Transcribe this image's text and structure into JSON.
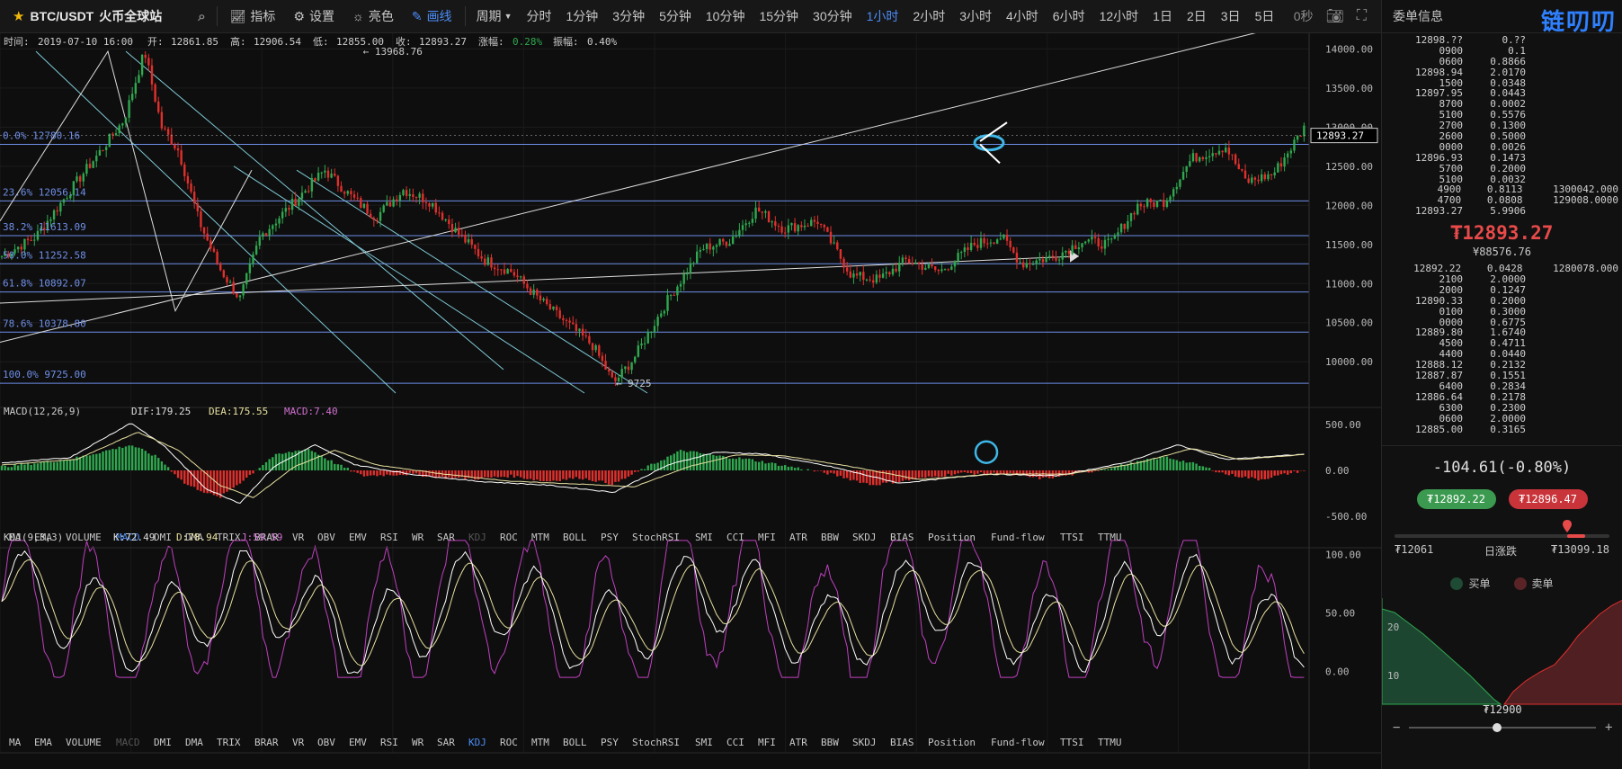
{
  "toolbar": {
    "symbol": "BTC/USDT",
    "exchange": "火币全球站",
    "indicators_label": "指标",
    "settings_label": "设置",
    "theme_label": "亮色",
    "draw_label": "画线",
    "period_label": "周期",
    "periods": [
      "分时",
      "1分钟",
      "3分钟",
      "5分钟",
      "10分钟",
      "15分钟",
      "30分钟",
      "1小时",
      "2小时",
      "3小时",
      "4小时",
      "6小时",
      "12小时",
      "1日",
      "2日",
      "3日",
      "5日"
    ],
    "active_period": "1小时",
    "countdown": "0秒"
  },
  "info_bar": {
    "time_label": "时间:",
    "time": "2019-07-10 16:00",
    "open_label": "开:",
    "open": "12861.85",
    "high_label": "高:",
    "high": "12906.54",
    "low_label": "低:",
    "low": "12855.00",
    "close_label": "收:",
    "close": "12893.27",
    "change_label": "涨幅:",
    "change": "0.28%",
    "amp_label": "振幅:",
    "amp": "0.40%"
  },
  "colors": {
    "up": "#2fa84f",
    "down": "#e0302d",
    "fib": "#6f8fe8",
    "channel": "#7fc9d6",
    "highlight": "#3fb8e8",
    "last": "#ffffff"
  },
  "chart_data": [
    {
      "type": "candlestick",
      "ylim": [
        9600,
        14200
      ],
      "yticks": [
        "14000.00",
        "13500.00",
        "13000.00",
        "12500.00",
        "12000.00",
        "11500.00",
        "11000.00",
        "10500.00",
        "10000.00"
      ],
      "last_price": 12893.27,
      "last_price_label": "12893.27",
      "annotations": {
        "high_label": "← 13968.76",
        "low_label": "← 9725"
      },
      "fibonacci": [
        {
          "label": "0.0% 12780.16",
          "value": 12780.16
        },
        {
          "label": "23.6% 12056.14",
          "value": 12056.14
        },
        {
          "label": "38.2% 11613.09",
          "value": 11613.09
        },
        {
          "label": "50.0% 11252.58",
          "value": 11252.58
        },
        {
          "label": "61.8% 10892.07",
          "value": 10892.07
        },
        {
          "label": "78.6% 10378.80",
          "value": 10378.8
        },
        {
          "label": "100.0% 9725.00",
          "value": 9725.0
        }
      ],
      "anchors": [
        [
          0,
          11350
        ],
        [
          10,
          11600
        ],
        [
          22,
          12300
        ],
        [
          30,
          12750
        ],
        [
          36,
          13100
        ],
        [
          42,
          13968.76
        ],
        [
          47,
          13000
        ],
        [
          52,
          12700
        ],
        [
          58,
          11800
        ],
        [
          64,
          11200
        ],
        [
          70,
          10800
        ],
        [
          76,
          11600
        ],
        [
          85,
          12000
        ],
        [
          95,
          12450
        ],
        [
          103,
          12100
        ],
        [
          110,
          11850
        ],
        [
          118,
          12200
        ],
        [
          126,
          12050
        ],
        [
          134,
          11650
        ],
        [
          142,
          11300
        ],
        [
          150,
          11150
        ],
        [
          158,
          10800
        ],
        [
          166,
          10500
        ],
        [
          174,
          10200
        ],
        [
          180,
          9725
        ],
        [
          186,
          10050
        ],
        [
          196,
          10800
        ],
        [
          206,
          11450
        ],
        [
          214,
          11550
        ],
        [
          222,
          11950
        ],
        [
          230,
          11700
        ],
        [
          240,
          11800
        ],
        [
          250,
          11100
        ],
        [
          258,
          11050
        ],
        [
          266,
          11300
        ],
        [
          276,
          11150
        ],
        [
          286,
          11500
        ],
        [
          294,
          11600
        ],
        [
          300,
          11250
        ],
        [
          310,
          11350
        ],
        [
          318,
          11550
        ],
        [
          326,
          11500
        ],
        [
          334,
          12000
        ],
        [
          342,
          12050
        ],
        [
          350,
          12600
        ],
        [
          360,
          12750
        ],
        [
          366,
          12300
        ],
        [
          374,
          12400
        ],
        [
          384,
          13050
        ]
      ]
    },
    {
      "type": "bar",
      "name": "MACD(12,26,9)",
      "legend": {
        "dif": "DIF:179.25",
        "dea": "DEA:175.55",
        "macd": "MACD:7.40"
      },
      "ylim": [
        -650,
        650
      ],
      "yticks": [
        "500.00",
        "0.00",
        "-500.00"
      ],
      "macd_anchors": [
        [
          0,
          40
        ],
        [
          20,
          120
        ],
        [
          38,
          280
        ],
        [
          46,
          140
        ],
        [
          54,
          -150
        ],
        [
          64,
          -300
        ],
        [
          72,
          -80
        ],
        [
          80,
          160
        ],
        [
          90,
          240
        ],
        [
          98,
          80
        ],
        [
          106,
          -60
        ],
        [
          120,
          -40
        ],
        [
          130,
          -80
        ],
        [
          140,
          -90
        ],
        [
          150,
          -60
        ],
        [
          160,
          -120
        ],
        [
          170,
          -80
        ],
        [
          180,
          -150
        ],
        [
          190,
          40
        ],
        [
          200,
          220
        ],
        [
          210,
          160
        ],
        [
          220,
          120
        ],
        [
          232,
          40
        ],
        [
          244,
          -40
        ],
        [
          256,
          -160
        ],
        [
          268,
          -100
        ],
        [
          282,
          -30
        ],
        [
          296,
          -40
        ],
        [
          306,
          -90
        ],
        [
          318,
          -30
        ],
        [
          330,
          60
        ],
        [
          342,
          150
        ],
        [
          350,
          80
        ],
        [
          360,
          -40
        ],
        [
          370,
          -100
        ],
        [
          384,
          7.4
        ]
      ],
      "dif_anchors": [
        [
          0,
          80
        ],
        [
          20,
          140
        ],
        [
          38,
          520
        ],
        [
          48,
          260
        ],
        [
          60,
          -200
        ],
        [
          70,
          -360
        ],
        [
          80,
          40
        ],
        [
          92,
          280
        ],
        [
          104,
          60
        ],
        [
          120,
          -40
        ],
        [
          140,
          -120
        ],
        [
          160,
          -160
        ],
        [
          180,
          -240
        ],
        [
          196,
          60
        ],
        [
          210,
          200
        ],
        [
          224,
          180
        ],
        [
          244,
          40
        ],
        [
          264,
          -140
        ],
        [
          290,
          -40
        ],
        [
          310,
          -60
        ],
        [
          330,
          80
        ],
        [
          346,
          280
        ],
        [
          360,
          120
        ],
        [
          384,
          179.25
        ]
      ],
      "dea_anchors": [
        [
          0,
          60
        ],
        [
          22,
          120
        ],
        [
          40,
          420
        ],
        [
          52,
          220
        ],
        [
          64,
          -160
        ],
        [
          74,
          -300
        ],
        [
          86,
          40
        ],
        [
          98,
          220
        ],
        [
          110,
          60
        ],
        [
          130,
          -40
        ],
        [
          150,
          -120
        ],
        [
          170,
          -150
        ],
        [
          186,
          -180
        ],
        [
          202,
          40
        ],
        [
          216,
          170
        ],
        [
          230,
          160
        ],
        [
          250,
          40
        ],
        [
          270,
          -100
        ],
        [
          292,
          -40
        ],
        [
          314,
          -40
        ],
        [
          334,
          80
        ],
        [
          350,
          240
        ],
        [
          364,
          120
        ],
        [
          384,
          175.55
        ]
      ]
    },
    {
      "type": "line",
      "name": "KDJ(9,3,3)",
      "legend": {
        "k": "K:72.49",
        "d": "D:78.94",
        "j": "J:59.59"
      },
      "ylim": [
        -8,
        115
      ],
      "yticks": [
        "100.00",
        "50.00",
        "0.00"
      ]
    }
  ],
  "indicator_tabs": [
    "MA",
    "EMA",
    "VOLUME",
    "MACD",
    "DMI",
    "DMA",
    "TRIX",
    "BRAR",
    "VR",
    "OBV",
    "EMV",
    "RSI",
    "WR",
    "SAR",
    "KDJ",
    "ROC",
    "MTM",
    "BOLL",
    "PSY",
    "StochRSI",
    "SMI",
    "CCI",
    "MFI",
    "ATR",
    "BBW",
    "SKDJ",
    "BIAS",
    "Position",
    "Fund-flow",
    "TTSI",
    "TTMU"
  ],
  "indicator_tabs_1": {
    "active": "MACD",
    "dim": "KDJ"
  },
  "indicator_tabs_2": {
    "active": "KDJ",
    "dim": "MACD"
  },
  "right_panel": {
    "title": "委单信息",
    "logo": "链叨叨",
    "asks": [
      [
        "12898.??",
        "0.??"
      ],
      [
        "0900",
        "0.1"
      ],
      [
        "0600",
        "0.8866"
      ],
      [
        "12898.94",
        "2.0170"
      ],
      [
        "1500",
        "0.0348"
      ],
      [
        "12897.95",
        "0.0443"
      ],
      [
        "8700",
        "0.0002"
      ],
      [
        "5100",
        "0.5576"
      ],
      [
        "2700",
        "0.1300"
      ],
      [
        "2600",
        "0.5000"
      ],
      [
        "0000",
        "0.0026"
      ],
      [
        "12896.93",
        "0.1473"
      ],
      [
        "5700",
        "0.2000"
      ],
      [
        "5100",
        "0.0032"
      ],
      [
        "4900",
        "0.8113"
      ],
      [
        "4700",
        "0.0808"
      ],
      [
        "12893.27",
        "5.9906"
      ]
    ],
    "ask_agg": [
      [
        "13000",
        "42.000"
      ],
      [
        "12900",
        "8.0000"
      ]
    ],
    "last_price": "₮12893.27",
    "last_cny": "¥88576.76",
    "bids": [
      [
        "12892.22",
        "0.0428"
      ],
      [
        "2100",
        "2.0000"
      ],
      [
        "2000",
        "0.1247"
      ],
      [
        "12890.33",
        "0.2000"
      ],
      [
        "0100",
        "0.3000"
      ],
      [
        "0000",
        "0.6775"
      ],
      [
        "12889.80",
        "1.6740"
      ],
      [
        "4500",
        "0.4711"
      ],
      [
        "4400",
        "0.0440"
      ],
      [
        "12888.12",
        "0.2132"
      ],
      [
        "12887.87",
        "0.1551"
      ],
      [
        "6400",
        "0.2834"
      ],
      [
        "12886.64",
        "0.2178"
      ],
      [
        "6300",
        "0.2300"
      ],
      [
        "0600",
        "2.0000"
      ],
      [
        "12885.00",
        "0.3165"
      ]
    ],
    "bid_agg": [
      [
        "12800",
        "78.000"
      ]
    ],
    "change": "-104.61(-0.80%)",
    "buy_price": "₮12892.22",
    "sell_price": "₮12896.47",
    "range_low": "₮12061",
    "range_label": "日涨跌",
    "range_high": "₮13099.18",
    "range_pos": 0.8,
    "buy_label": "买单",
    "sell_label": "卖单",
    "depth_center": "₮12900",
    "depth_tick": "20",
    "depth_tick2": "10"
  }
}
